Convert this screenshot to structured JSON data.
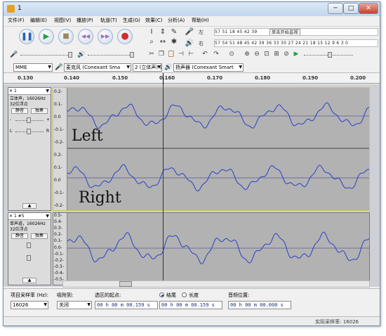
{
  "window": {
    "title": "1"
  },
  "title_buttons": {
    "minimize": "─",
    "maximize": "□",
    "close": "✕"
  },
  "menus": [
    "文件(F)",
    "编辑(E)",
    "视图(V)",
    "播放(P)",
    "轨道(T)",
    "生成(G)",
    "效果(C)",
    "分析(A)",
    "帮助(H)"
  ],
  "transport": {
    "pause_icon": "pause-icon",
    "play_icon": "play-icon",
    "stop_icon": "stop-icon",
    "skip_start_icon": "skip-to-start-icon",
    "skip_end_icon": "skip-to-end-icon",
    "record_icon": "record-icon"
  },
  "meter": {
    "ruler_left": "57  51  18  45  42  39  ",
    "click_label": "单击开始监视",
    "ruler_right": "  12  9  6  3  0",
    "ruler2": "57  54  51  48  45  42  39  36  33  30  27  24  21  18  15  12  9  6  3  0",
    "left_label": "左",
    "right_label": "右"
  },
  "device": {
    "host": "MME",
    "input": "麦克风 (Conexant Sma",
    "channels": "2 (立体声) 录",
    "output": "扬声器 (Conexant Smart"
  },
  "timeline": {
    "ticks": [
      "0.130",
      "0.140",
      "0.150",
      "0.160",
      "0.170",
      "0.180",
      "0.190",
      "0.200"
    ]
  },
  "track1": {
    "close": "✕",
    "name": "1",
    "menu_arrow": "▼",
    "info1": "立体声，16026Hz",
    "info2": "32位浮点",
    "mute": "静音",
    "solo": "独奏",
    "gain_minus": "-",
    "gain_plus": "+",
    "pan_l": "L",
    "pan_r": "R",
    "collapse": "▲",
    "y_labels_top": [
      "0.2-",
      "0.1-",
      "0.0",
      "-0.1-",
      "-0.2-"
    ],
    "y_labels_bottom": [
      "0.2-",
      "0.1-",
      "0.0",
      "-0.1-",
      "-0.2-"
    ],
    "left_channel_label": "Left",
    "right_channel_label": "Right"
  },
  "track2": {
    "close": "✕",
    "name": "1 #5",
    "menu_arrow": "▼",
    "info1": "单声道，16026Hz",
    "info2": "32位浮点",
    "mute": "静音",
    "solo": "独奏",
    "collapse": "▲",
    "y_labels": [
      "0.5-",
      "0.4-",
      "0.3-",
      "0.2-",
      "0.1-",
      "0.0-",
      "-0.1-",
      "-0.2-",
      "-0.3-",
      "-0.4-",
      "-0.5-"
    ]
  },
  "selection_bar": {
    "rate_label": "项目采样率 (Hz):",
    "rate_value": "16026",
    "snap_label": "吸附到:",
    "snap_value": "关闭",
    "start_label": "选区的起点:",
    "start_value": "00 h 00 m 00.159 s",
    "end_radio": "结尾",
    "length_radio": "长度",
    "end_value": "00 h 00 m 00.159 s",
    "audio_pos_label": "音频位置:",
    "audio_pos_value": "00 h 00 m 00.000 s"
  },
  "status": {
    "text": "实际采样率: 16026"
  },
  "waveform_color": "#2b3fc7"
}
